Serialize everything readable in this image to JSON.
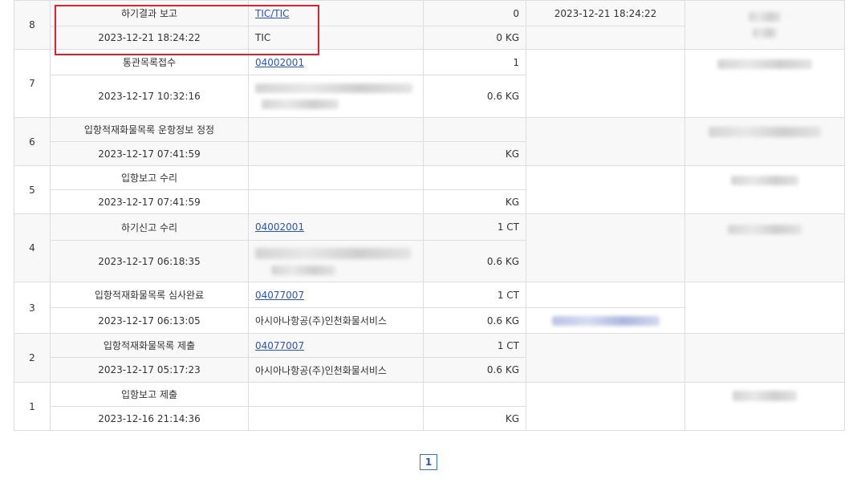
{
  "rows": [
    {
      "no": "8",
      "process": "하기결과 보고",
      "datetime": "2023-12-21 18:24:22",
      "ref": "TIC/TIC",
      "company": "TIC",
      "qty_count": "0",
      "qty_weight": "0 KG",
      "report_time": "2023-12-21 18:24:22"
    },
    {
      "no": "7",
      "process": "통관목록접수",
      "datetime": "2023-12-17 10:32:16",
      "ref": "04002001",
      "company": "",
      "qty_count": "1",
      "qty_weight": "0.6 KG",
      "report_time": ""
    },
    {
      "no": "6",
      "process": "입항적재화물목록 운항정보 정정",
      "datetime": "2023-12-17 07:41:59",
      "ref": "",
      "company": "",
      "qty_count": "",
      "qty_weight": "KG",
      "report_time": ""
    },
    {
      "no": "5",
      "process": "입항보고 수리",
      "datetime": "2023-12-17 07:41:59",
      "ref": "",
      "company": "",
      "qty_count": "",
      "qty_weight": "KG",
      "report_time": ""
    },
    {
      "no": "4",
      "process": "하기신고 수리",
      "datetime": "2023-12-17 06:18:35",
      "ref": "04002001",
      "company": "",
      "qty_count": "1 CT",
      "qty_weight": "0.6 KG",
      "report_time": ""
    },
    {
      "no": "3",
      "process": "입항적재화물목록 심사완료",
      "datetime": "2023-12-17 06:13:05",
      "ref": "04077007",
      "company": "아시아나항공(주)인천화물서비스",
      "qty_count": "1 CT",
      "qty_weight": "0.6 KG",
      "report_time": ""
    },
    {
      "no": "2",
      "process": "입항적재화물목록 제출",
      "datetime": "2023-12-17 05:17:23",
      "ref": "04077007",
      "company": "아시아나항공(주)인천화물서비스",
      "qty_count": "1 CT",
      "qty_weight": "0.6 KG",
      "report_time": ""
    },
    {
      "no": "1",
      "process": "입항보고 제출",
      "datetime": "2023-12-16 21:14:36",
      "ref": "",
      "company": "",
      "qty_count": "",
      "qty_weight": "KG",
      "report_time": ""
    }
  ],
  "pagination": {
    "current_page": "1"
  },
  "colors": {
    "link": "#2a55b8",
    "highlight": "#e0202a",
    "border": "#dddddd",
    "row_alt": "#f8f8f8"
  }
}
